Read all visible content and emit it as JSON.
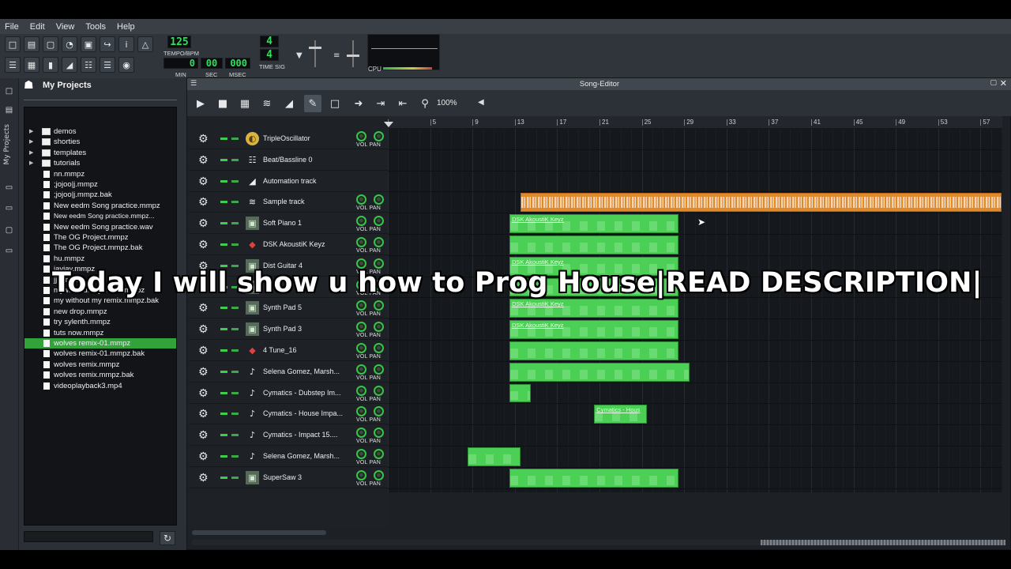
{
  "menu": [
    "File",
    "Edit",
    "View",
    "Tools",
    "Help"
  ],
  "transport": {
    "tempo": "125",
    "tempo_label": "TEMPO/BPM",
    "time": {
      "min": "0",
      "sec": "00",
      "msec": "000"
    },
    "time_labels": {
      "min": "MIN",
      "sec": "SEC",
      "msec": "MSEC"
    },
    "timesig_num": "4",
    "timesig_den": "4",
    "timesig_label": "TIME SIG",
    "cpu_label": "CPU"
  },
  "sidebar": {
    "title": "My Projects",
    "items": [
      {
        "label": "demos",
        "type": "folder"
      },
      {
        "label": "shorties",
        "type": "folder"
      },
      {
        "label": "templates",
        "type": "folder"
      },
      {
        "label": "tutorials",
        "type": "folder"
      },
      {
        "label": "nn.mmpz",
        "type": "file"
      },
      {
        "label": ";jojoo|j.mmpz",
        "type": "file"
      },
      {
        "label": ";jojoo|j.mmpz.bak",
        "type": "file"
      },
      {
        "label": "New eedm Song practice.mmpz",
        "type": "file"
      },
      {
        "label": "New eedm Song practice.mmpz...",
        "type": "file"
      },
      {
        "label": "New eedm Song practice.wav",
        "type": "file"
      },
      {
        "label": "The OG Project.mmpz",
        "type": "file"
      },
      {
        "label": "The OG Project.mmpz.bak",
        "type": "file"
      },
      {
        "label": "hu.mmpz",
        "type": "file"
      },
      {
        "label": "jayjay.mmpz",
        "type": "file"
      },
      {
        "label": "jj.mmpz",
        "type": "file"
      },
      {
        "label": "my without my remix.mmpz",
        "type": "file"
      },
      {
        "label": "my without my remix.mmpz.bak",
        "type": "file"
      },
      {
        "label": "new drop.mmpz",
        "type": "file"
      },
      {
        "label": "try sylenth.mmpz",
        "type": "file"
      },
      {
        "label": "tuts now.mmpz",
        "type": "file"
      },
      {
        "label": "wolves remix-01.mmpz",
        "type": "file",
        "selected": true
      },
      {
        "label": "wolves remix-01.mmpz.bak",
        "type": "file"
      },
      {
        "label": "wolves remix.mmpz",
        "type": "file"
      },
      {
        "label": "wolves remix.mmpz.bak",
        "type": "file"
      },
      {
        "label": "videoplayback3.mp4",
        "type": "file"
      }
    ]
  },
  "song_editor": {
    "title": "Song-Editor",
    "zoom": "100%",
    "bars": [
      "1",
      "5",
      "9",
      "13",
      "17",
      "21",
      "25",
      "29",
      "33",
      "37",
      "41",
      "45",
      "49",
      "53",
      "57"
    ],
    "vol_pan_label": "VOL PAN",
    "tracks": [
      {
        "name": "TripleOscillator",
        "icon": "triple-osc-icon",
        "knobs": true
      },
      {
        "name": "Beat/Bassline 0",
        "icon": "beat-bassline-icon",
        "knobs": false
      },
      {
        "name": "Automation track",
        "icon": "automation-icon",
        "knobs": false
      },
      {
        "name": "Sample track",
        "icon": "sample-icon",
        "knobs": true
      },
      {
        "name": "Soft Piano 1",
        "icon": "instrument-icon",
        "knobs": true
      },
      {
        "name": "DSK AkoustiK Keyz",
        "icon": "dsk-icon",
        "knobs": true
      },
      {
        "name": "Dist Guitar 4",
        "icon": "instrument-icon",
        "knobs": true
      },
      {
        "name": "",
        "icon": "instrument-icon",
        "knobs": true
      },
      {
        "name": "Synth Pad 5",
        "icon": "instrument-icon",
        "knobs": true
      },
      {
        "name": "Synth Pad 3",
        "icon": "instrument-icon",
        "knobs": true
      },
      {
        "name": "4 Tune_16",
        "icon": "dsk-icon",
        "knobs": true
      },
      {
        "name": "Selena Gomez, Marsh...",
        "icon": "note-icon",
        "knobs": true
      },
      {
        "name": "Cymatics - Dubstep Im...",
        "icon": "note-icon",
        "knobs": true
      },
      {
        "name": "Cymatics - House Impa...",
        "icon": "note-icon",
        "knobs": true
      },
      {
        "name": "Cymatics - Impact 15....",
        "icon": "note-icon",
        "knobs": true
      },
      {
        "name": "Selena Gomez, Marsh...",
        "icon": "note-icon",
        "knobs": true
      },
      {
        "name": "SuperSaw 3",
        "icon": "instrument-icon",
        "knobs": true
      }
    ],
    "clips": [
      {
        "track": 3,
        "start": 13.5,
        "end": 59,
        "kind": "sample",
        "label": ""
      },
      {
        "track": 4,
        "start": 12.5,
        "end": 28.5,
        "label": "DSK AkoustiK Keyz"
      },
      {
        "track": 5,
        "start": 12.5,
        "end": 28.5,
        "label": ""
      },
      {
        "track": 6,
        "start": 12.5,
        "end": 28.5,
        "label": "DSK AkoustiK Keyz"
      },
      {
        "track": 7,
        "start": 12.5,
        "end": 28.5,
        "label": ""
      },
      {
        "track": 8,
        "start": 12.5,
        "end": 28.5,
        "label": "DSK AkoustiK Keyz"
      },
      {
        "track": 9,
        "start": 12.5,
        "end": 28.5,
        "label": "DSK AkoustiK Keyz"
      },
      {
        "track": 10,
        "start": 12.5,
        "end": 28.5,
        "label": ""
      },
      {
        "track": 11,
        "start": 12.5,
        "end": 29.5,
        "label": ""
      },
      {
        "track": 12,
        "start": 12.5,
        "end": 14.5,
        "label": ""
      },
      {
        "track": 13,
        "start": 20.5,
        "end": 25.5,
        "label": "Cymatics - Hous"
      },
      {
        "track": 15,
        "start": 8.5,
        "end": 13.5,
        "label": ""
      },
      {
        "track": 16,
        "start": 12.5,
        "end": 28.5,
        "label": ""
      }
    ]
  },
  "caption": "Today I will show u how to Prog House|READ DESCRIPTION|"
}
